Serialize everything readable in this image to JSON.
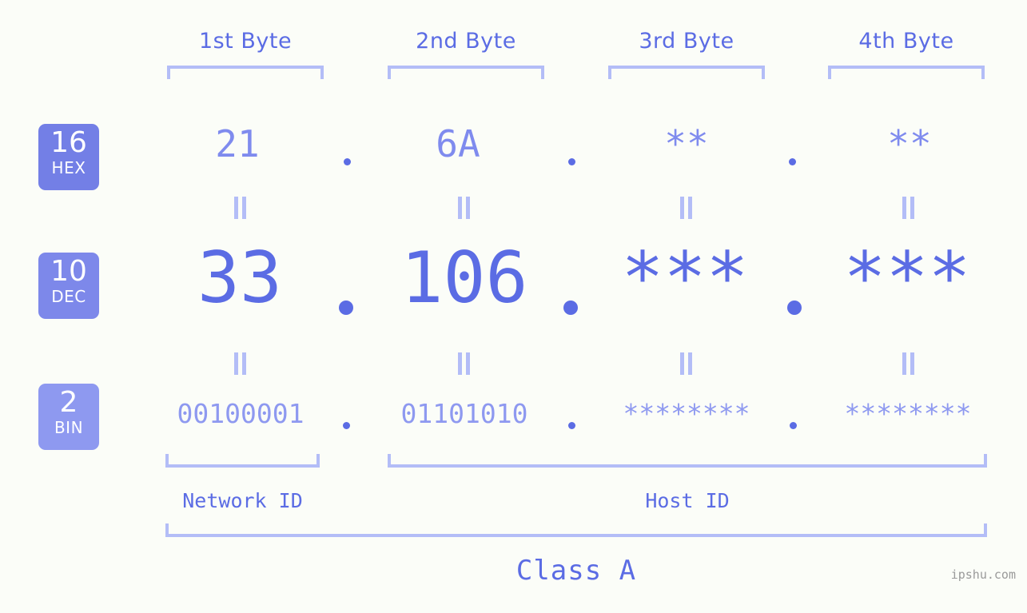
{
  "meta": {
    "background_color": "#fbfdf8",
    "accent_color": "#5b6ce4",
    "light_accent_color": "#b3bdf7",
    "badge_color": "#737fe6"
  },
  "headers": [
    {
      "label": "1st Byte"
    },
    {
      "label": "2nd Byte"
    },
    {
      "label": "3rd Byte"
    },
    {
      "label": "4th Byte"
    }
  ],
  "bases": [
    {
      "number": "16",
      "name": "HEX"
    },
    {
      "number": "10",
      "name": "DEC"
    },
    {
      "number": "2",
      "name": "BIN"
    }
  ],
  "rows": {
    "hex": {
      "values": [
        "21",
        "6A",
        "**",
        "**"
      ]
    },
    "dec": {
      "values": [
        "33",
        "106",
        "***",
        "***"
      ]
    },
    "bin": {
      "values": [
        "00100001",
        "01101010",
        "********",
        "********"
      ]
    }
  },
  "separators": {
    "dot": ".",
    "equals": "="
  },
  "segments": [
    {
      "label": "Network ID"
    },
    {
      "label": "Host ID"
    }
  ],
  "class": {
    "label": "Class A"
  },
  "watermark": {
    "text": "ipshu.com"
  }
}
